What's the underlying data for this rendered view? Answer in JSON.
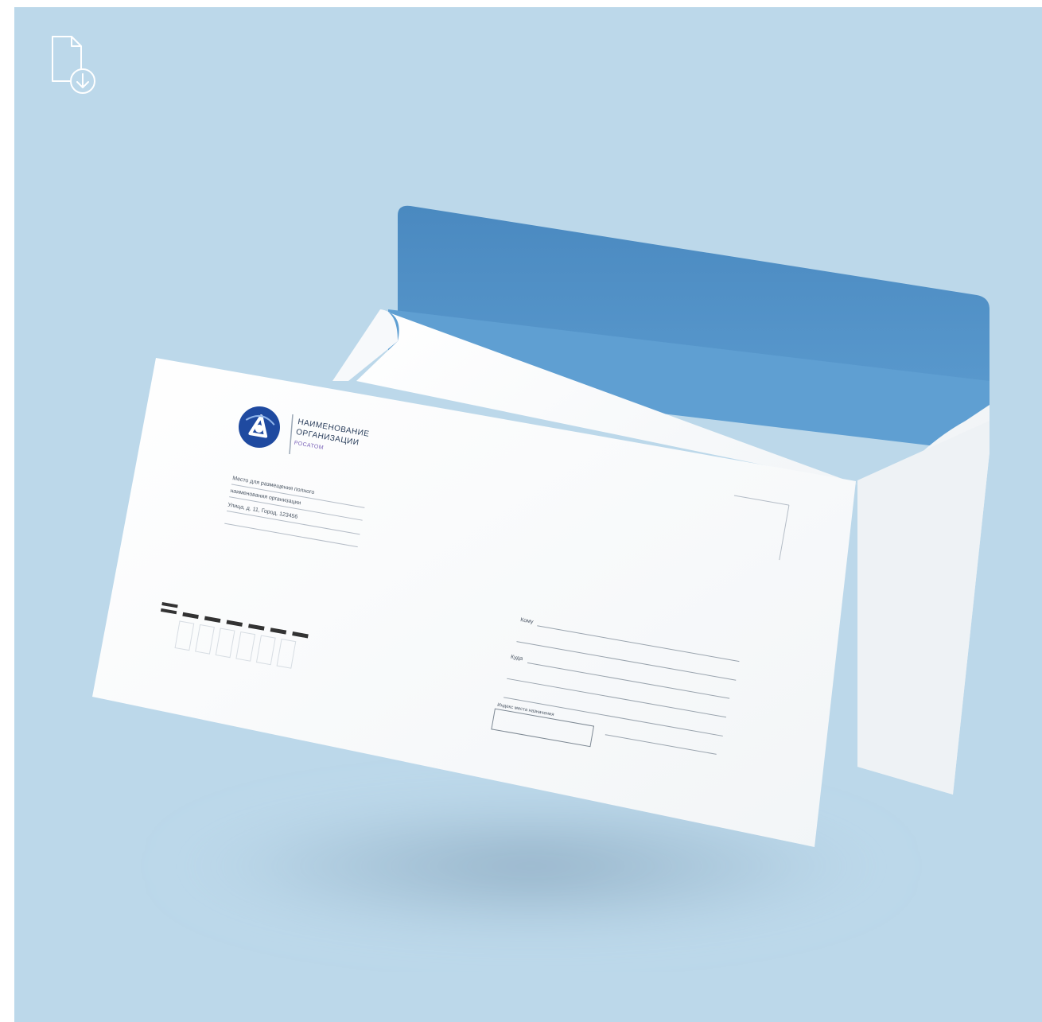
{
  "scene": {
    "background_color": "#bcd8ea",
    "envelope_inner_color": "#4f8ec4",
    "envelope_paper_color": "#fbfcfd",
    "download_icon": "file-download-icon"
  },
  "logo": {
    "line1": "НАИМЕНОВАНИЕ",
    "line2": "ОРГАНИЗАЦИИ",
    "line3": "РОСАТОМ"
  },
  "return_address": {
    "line1": "Место для размещения полного",
    "line2": "наименования организации",
    "line3": "Улица, д. 11, Город, 123456"
  },
  "recipient": {
    "to_label": "Кому",
    "where_label": "Куда",
    "postcode_label": "Индекс места назначения"
  }
}
